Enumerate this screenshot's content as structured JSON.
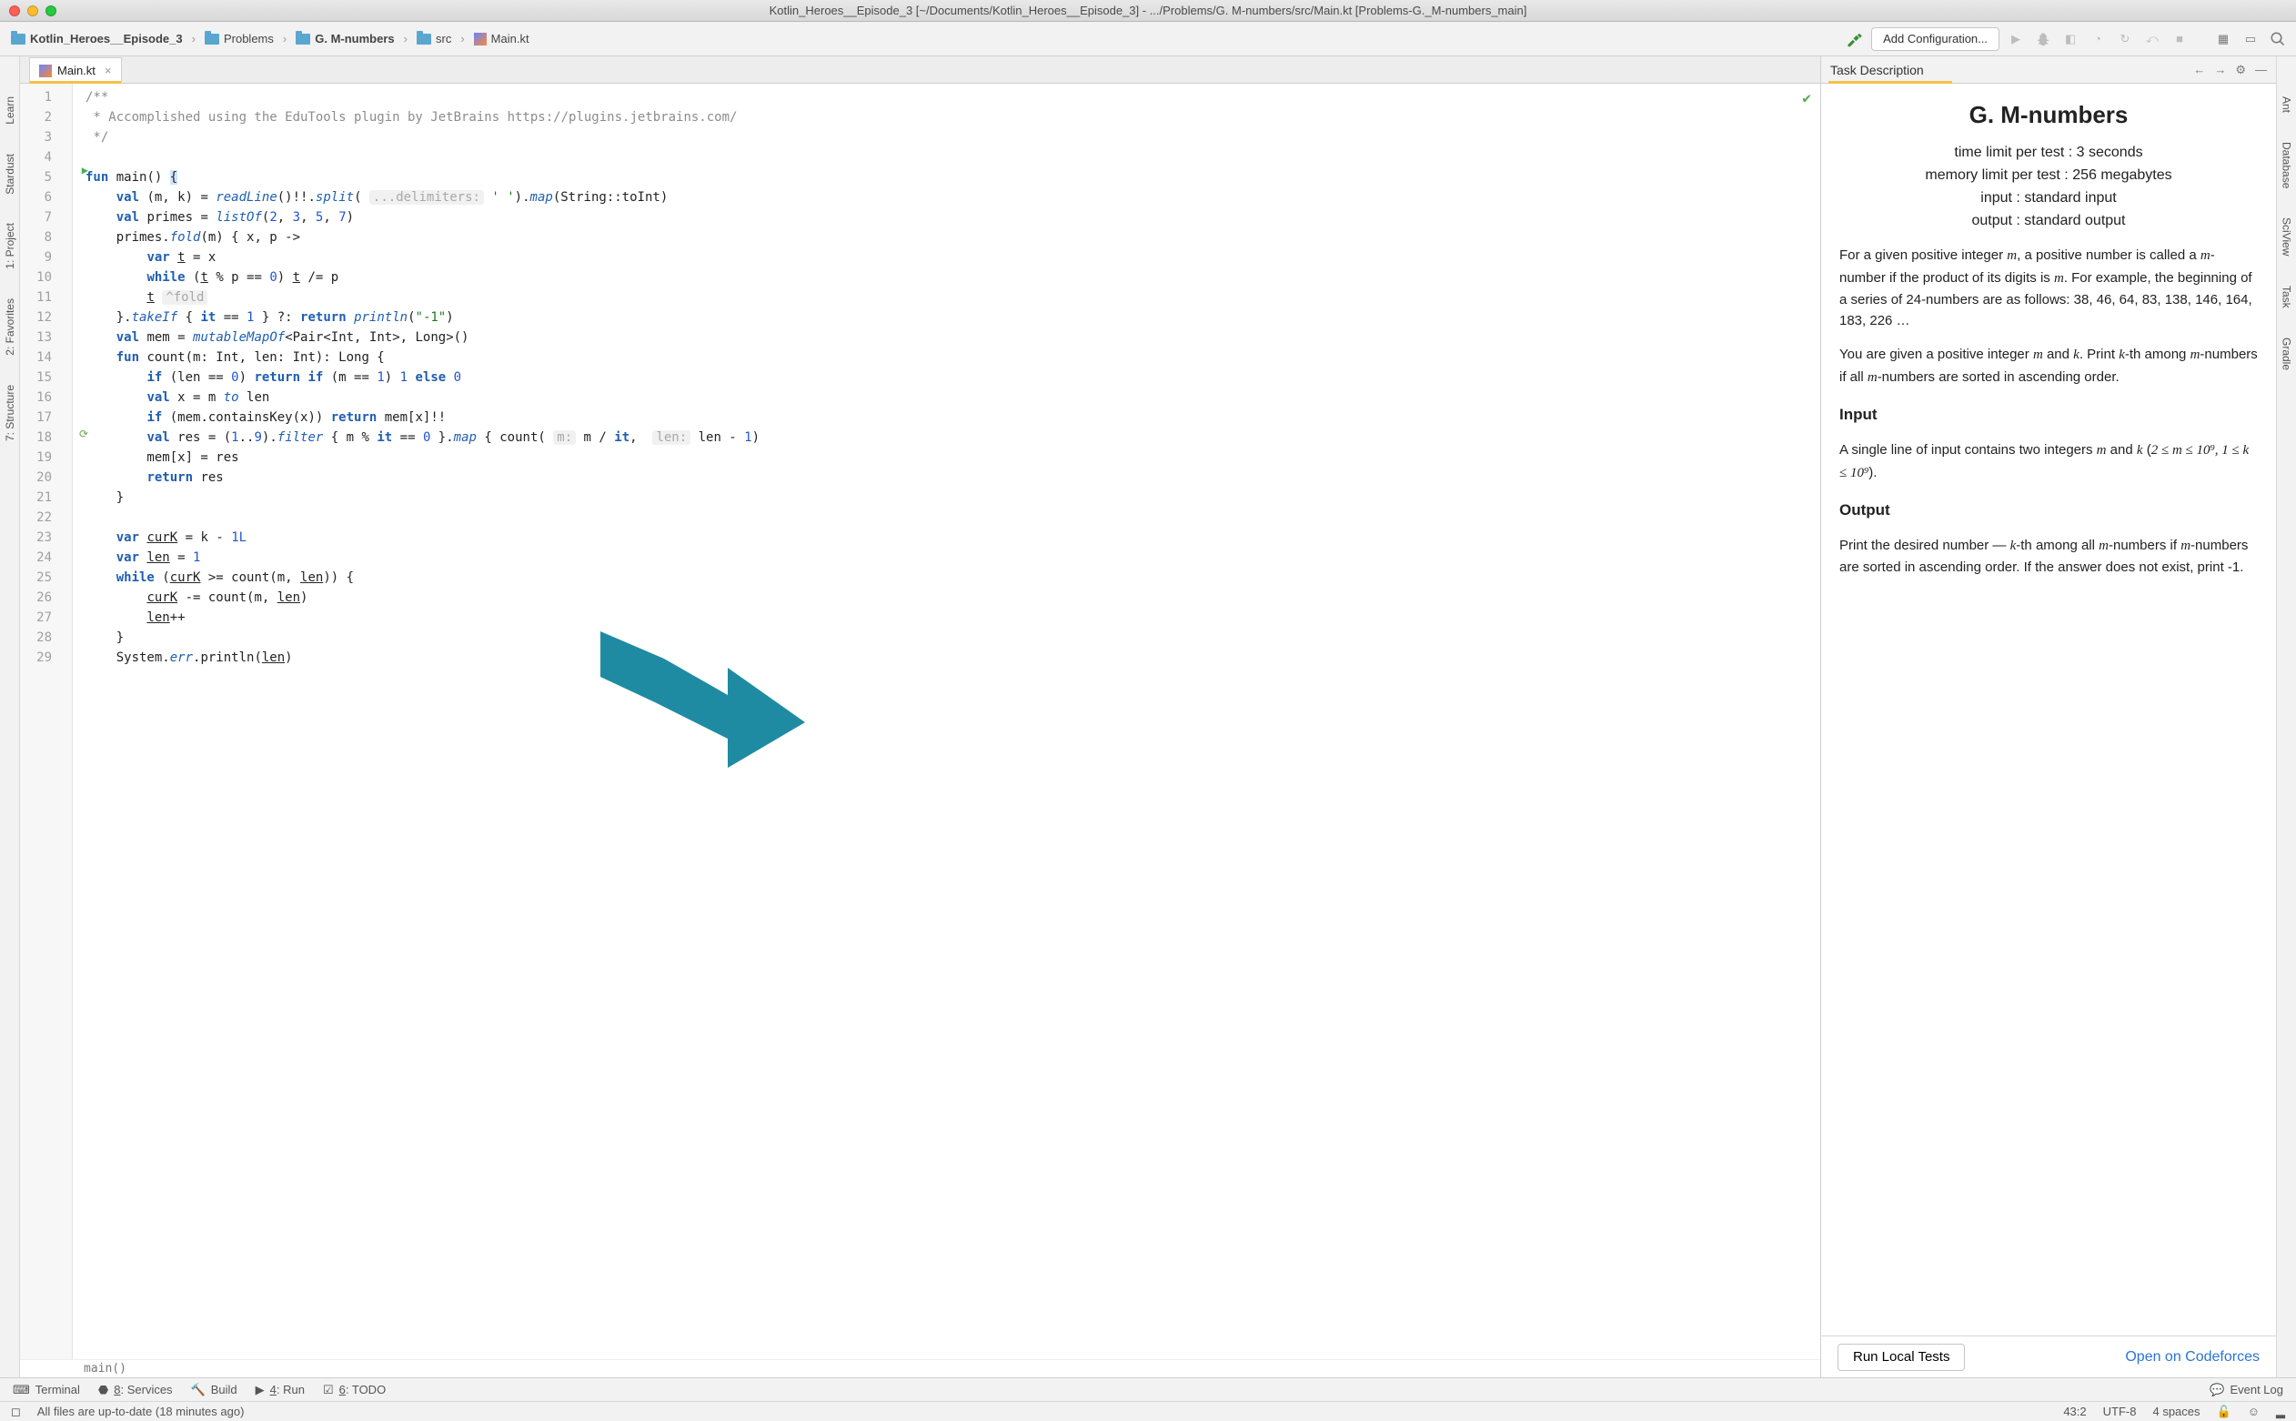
{
  "window": {
    "title": "Kotlin_Heroes__Episode_3 [~/Documents/Kotlin_Heroes__Episode_3] - .../Problems/G. M-numbers/src/Main.kt [Problems-G._M-numbers_main]"
  },
  "breadcrumbs": {
    "project": "Kotlin_Heroes__Episode_3",
    "problems": "Problems",
    "task": "G. M-numbers",
    "src": "src",
    "file": "Main.kt"
  },
  "toolbar": {
    "run_config": "Add Configuration..."
  },
  "left_tools": [
    "Learn",
    "Stardust",
    "1: Project",
    "2: Favorites",
    "7: Structure"
  ],
  "right_tools": [
    "Ant",
    "Database",
    "SciView",
    "Task",
    "Gradle"
  ],
  "editor": {
    "tab": "Main.kt",
    "breadcrumb_fn": "main()",
    "lines": [
      "1",
      "2",
      "3",
      "4",
      "5",
      "6",
      "7",
      "8",
      "9",
      "10",
      "11",
      "12",
      "13",
      "14",
      "15",
      "16",
      "17",
      "18",
      "19",
      "20",
      "21",
      "22",
      "23",
      "24",
      "25",
      "26",
      "27",
      "28",
      "29"
    ]
  },
  "task_panel": {
    "header": "Task Description",
    "title": "G. M-numbers",
    "meta": {
      "time": "time limit per test : 3 seconds",
      "memory": "memory limit per test : 256 megabytes",
      "input": "input : standard input",
      "output": "output : standard output"
    },
    "p1a": "For a given positive integer ",
    "p1b": ", a positive number is called a ",
    "p1c": "-number if the product of its digits is ",
    "p1d": ". For example, the beginning of a series of ",
    "p1e": "-numbers are as follows: ",
    "p1nums": "38, 46, 64, 83, 138, 146, 164, 183, 226 …",
    "p2a": "You are given a positive integer ",
    "p2b": " and ",
    "p2c": ". Print ",
    "p2d": "-th among ",
    "p2e": "-numbers if all ",
    "p2f": "-numbers are sorted in ascending order.",
    "input_h": "Input",
    "input_t1": "A single line of input contains two integers ",
    "input_t2": " and ",
    "input_t3": " (",
    "input_range": "2 ≤ m ≤ 10⁹, 1 ≤ k ≤ 10⁹",
    "input_t4": ").",
    "output_h": "Output",
    "out_t1": "Print the desired number — ",
    "out_t2": "-th among all ",
    "out_t3": "-numbers if ",
    "out_t4": "-numbers are sorted in ascending order. If the answer does not exist, print -1.",
    "run_btn": "Run Local Tests",
    "open_link": "Open on Codeforces"
  },
  "bottom": {
    "terminal": "Terminal",
    "services": "8: Services",
    "build": "Build",
    "run": "4: Run",
    "todo": "6: TODO",
    "eventlog": "Event Log"
  },
  "status": {
    "msg": "All files are up-to-date (18 minutes ago)",
    "pos": "43:2",
    "enc": "UTF-8",
    "indent": "4 spaces"
  }
}
